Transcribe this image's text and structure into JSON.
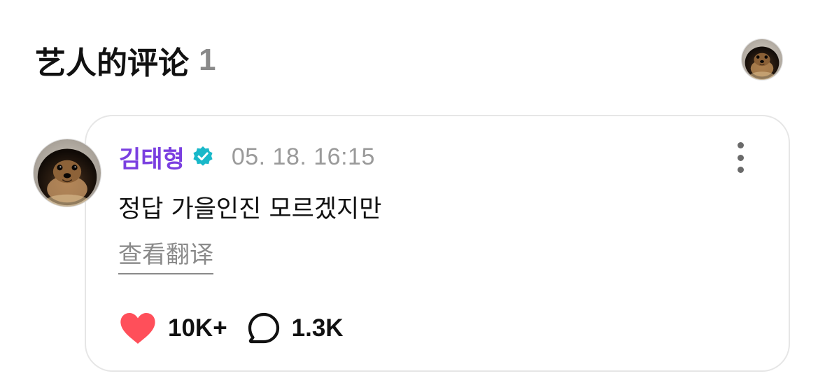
{
  "section": {
    "title": "艺人的评论",
    "count": "1"
  },
  "comment": {
    "author": "김태형",
    "timestamp": "05. 18. 16:15",
    "text": "정답 가을인진 모르겠지만",
    "translate_label": "查看翻译",
    "like_count": "10K+",
    "reply_count": "1.3K"
  },
  "icons": {
    "verified": "verified-badge-icon",
    "more": "more-vertical-icon",
    "like": "heart-icon",
    "reply": "speech-bubble-icon"
  },
  "colors": {
    "author_name": "#7a3fe0",
    "verified_badge": "#19b8c9",
    "heart": "#ff4f5a",
    "count_gray": "#8a8a8a",
    "timestamp_gray": "#9a9a9a"
  }
}
